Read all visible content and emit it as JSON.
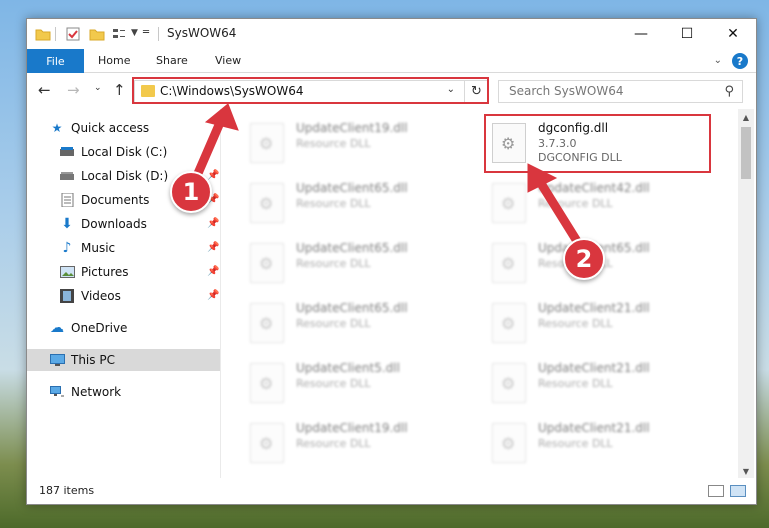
{
  "window": {
    "title": "SysWOW64",
    "buttons": {
      "minimize": "—",
      "maximize": "☐",
      "close": "✕"
    }
  },
  "ribbon": {
    "tabs": [
      "File",
      "Home",
      "Share",
      "View"
    ],
    "help": "?"
  },
  "navigation": {
    "address": "C:\\Windows\\SysWOW64",
    "search_placeholder": "Search SysWOW64"
  },
  "sidebar": {
    "items": [
      {
        "label": "Quick access",
        "icon": "star-icon",
        "color": "#1979ca"
      },
      {
        "label": "Local Disk (C:)",
        "icon": "drive-icon"
      },
      {
        "label": "Local Disk (D:)",
        "icon": "drive-icon"
      },
      {
        "label": "Documents",
        "icon": "documents-icon"
      },
      {
        "label": "Downloads",
        "icon": "download-icon",
        "color": "#1979ca"
      },
      {
        "label": "Music",
        "icon": "music-icon",
        "color": "#1979ca"
      },
      {
        "label": "Pictures",
        "icon": "pictures-icon"
      },
      {
        "label": "Videos",
        "icon": "videos-icon"
      },
      {
        "label": "OneDrive",
        "icon": "cloud-icon",
        "color": "#1979ca"
      },
      {
        "label": "This PC",
        "icon": "computer-icon",
        "selected": true
      },
      {
        "label": "Network",
        "icon": "network-icon"
      }
    ]
  },
  "files": [
    {
      "name": "UpdateClient19.dll",
      "desc": "Resource DLL",
      "blur": true
    },
    {
      "name": "dgconfig.dll",
      "version": "3.7.3.0",
      "desc": "DGCONFIG DLL",
      "blur": false
    },
    {
      "name": "UpdateClient65.dll",
      "desc": "Resource DLL",
      "blur": true
    },
    {
      "name": "UpdateClient42.dll",
      "desc": "Resource DLL",
      "blur": true
    },
    {
      "name": "UpdateClient65.dll",
      "desc": "Resource DLL",
      "blur": true
    },
    {
      "name": "UpdateClient65.dll",
      "desc": "Resource DLL",
      "blur": true
    },
    {
      "name": "UpdateClient65.dll",
      "desc": "Resource DLL",
      "blur": true
    },
    {
      "name": "UpdateClient21.dll",
      "desc": "Resource DLL",
      "blur": true
    },
    {
      "name": "UpdateClient5.dll",
      "desc": "Resource DLL",
      "blur": true
    },
    {
      "name": "UpdateClient21.dll",
      "desc": "Resource DLL",
      "blur": true
    },
    {
      "name": "UpdateClient19.dll",
      "desc": "Resource DLL",
      "blur": true
    },
    {
      "name": "UpdateClient21.dll",
      "desc": "Resource DLL",
      "blur": true
    }
  ],
  "status": {
    "items_count": "187 items"
  },
  "annotations": {
    "step1": "1",
    "step2": "2",
    "color": "#d9363e"
  }
}
